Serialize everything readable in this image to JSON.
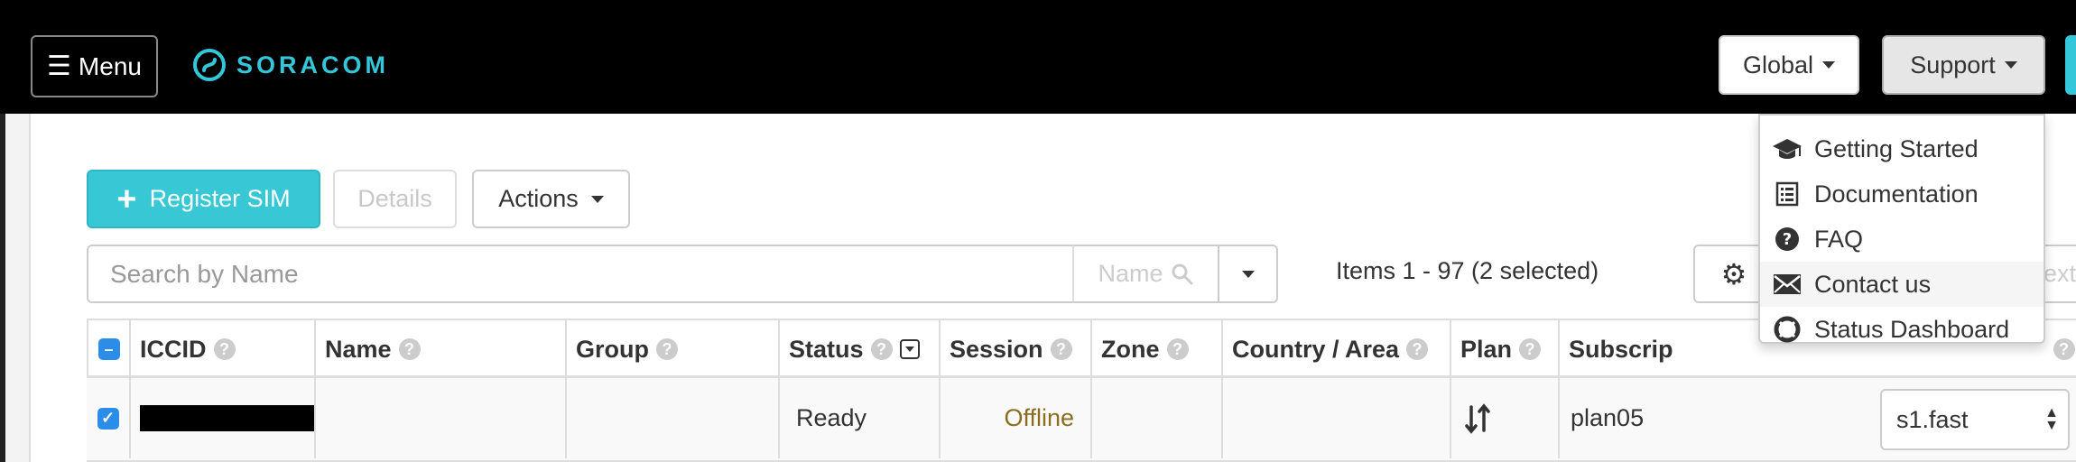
{
  "navbar": {
    "menu_label": "Menu",
    "brand": "SORACOM",
    "global_label": "Global",
    "support_label": "Support"
  },
  "toolbar": {
    "register_label": "Register SIM",
    "details_label": "Details",
    "actions_label": "Actions"
  },
  "search": {
    "placeholder": "Search by Name",
    "field_label": "Name",
    "items_text": "Items 1 - 97 (2 selected)",
    "next_label": "ext"
  },
  "table": {
    "headers": [
      "ICCID",
      "Name",
      "Group",
      "Status",
      "Session",
      "Zone",
      "Country / Area",
      "Plan",
      "Subscrip"
    ],
    "row": {
      "status": "Ready",
      "session": "Offline",
      "subscription": "plan05",
      "speed_class": "s1.fast"
    }
  },
  "support_menu": {
    "items": [
      {
        "label": "Getting Started",
        "icon": "graduation-cap-icon"
      },
      {
        "label": "Documentation",
        "icon": "list-alt-icon"
      },
      {
        "label": "FAQ",
        "icon": "question-circle-icon"
      },
      {
        "label": "Contact us",
        "icon": "envelope-icon"
      },
      {
        "label": "Status Dashboard",
        "icon": "life-ring-icon"
      }
    ],
    "active_index": 3
  },
  "colors": {
    "brand": "#34c7d9",
    "primary_button": "#37c7d5",
    "checkbox": "#2b8de8",
    "offline_text": "#8a6d1e"
  }
}
